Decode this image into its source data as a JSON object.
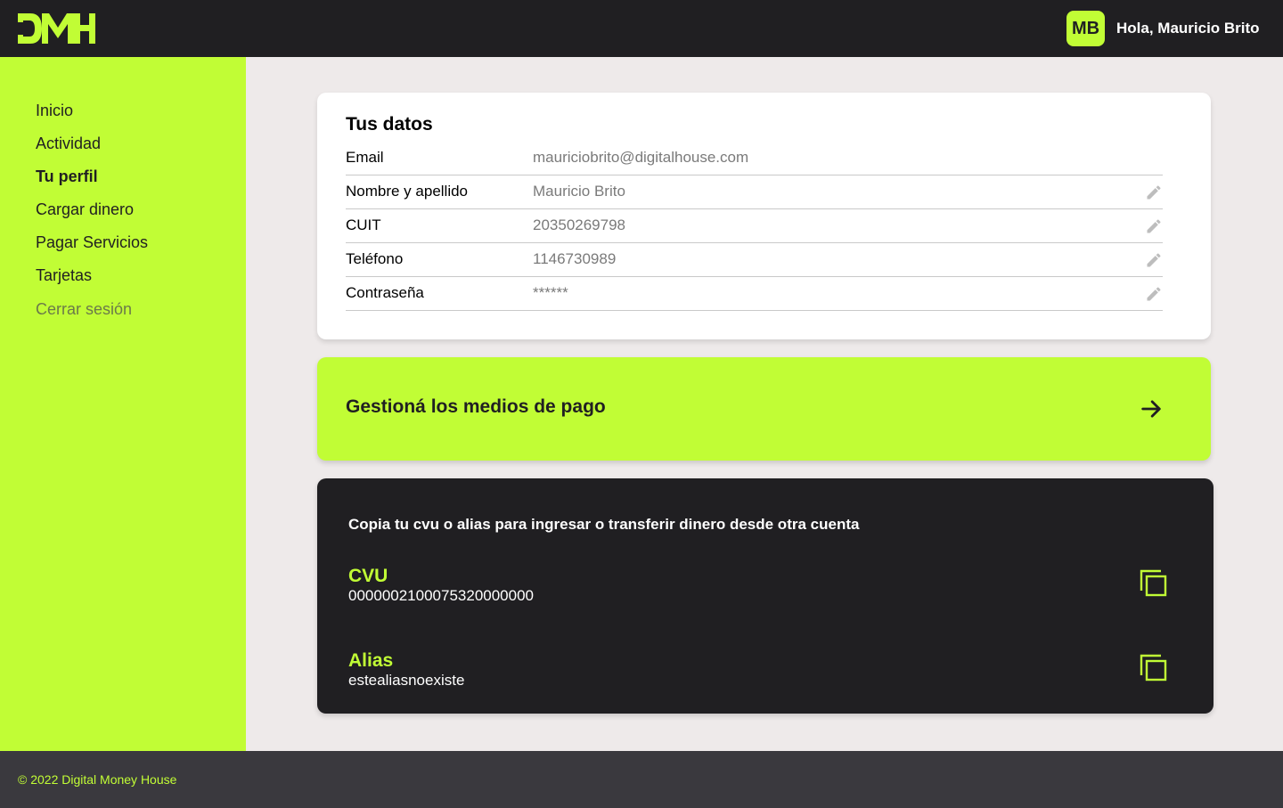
{
  "header": {
    "logo_text": "DMH",
    "avatar_initials": "MB",
    "greeting": "Hola, Mauricio Brito"
  },
  "sidebar": {
    "items": [
      {
        "label": "Inicio"
      },
      {
        "label": "Actividad"
      },
      {
        "label": "Tu perfil",
        "active": true
      },
      {
        "label": "Cargar dinero"
      },
      {
        "label": "Pagar Servicios"
      },
      {
        "label": "Tarjetas"
      },
      {
        "label": "Cerrar sesión"
      }
    ]
  },
  "profile": {
    "title": "Tus datos",
    "fields": [
      {
        "label": "Email",
        "value": "mauriciobrito@digitalhouse.com",
        "editable": false
      },
      {
        "label": "Nombre y apellido",
        "value": "Mauricio Brito",
        "editable": true
      },
      {
        "label": "CUIT",
        "value": "20350269798",
        "editable": true
      },
      {
        "label": "Teléfono",
        "value": "1146730989",
        "editable": true
      },
      {
        "label": "Contraseña",
        "value": "******",
        "editable": true
      }
    ]
  },
  "payment": {
    "label": "Gestioná los medios de pago"
  },
  "account": {
    "intro": "Copia tu cvu o alias para ingresar o transferir dinero desde otra cuenta",
    "cvu_title": "CVU",
    "cvu_value": "0000002100075320000000",
    "alias_title": "Alias",
    "alias_value": "estealiasnoexiste"
  },
  "footer": {
    "text": "© 2022 Digital Money House"
  },
  "colors": {
    "accent": "#c1fd35",
    "dark": "#201f22",
    "background": "#eeeaea",
    "footer": "#3a393e"
  },
  "icons": {
    "edit": "pencil-icon",
    "arrow": "arrow-right-icon",
    "copy": "copy-icon"
  }
}
